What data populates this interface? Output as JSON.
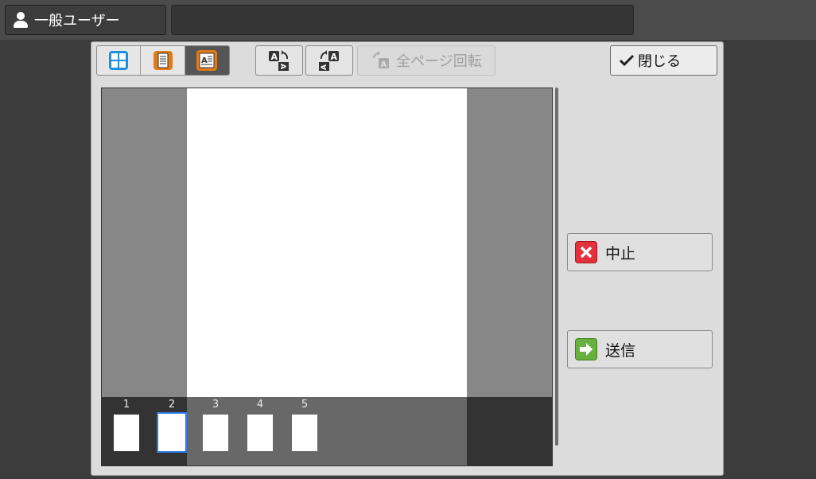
{
  "header": {
    "user_label": "一般ユーザー",
    "message": ""
  },
  "toolbar": {
    "view_modes": [
      {
        "name": "grid",
        "active": false
      },
      {
        "name": "page",
        "active": false
      },
      {
        "name": "page-detail",
        "active": true
      }
    ],
    "rotate_all_label": "全ページ回転",
    "close_label": "閉じる"
  },
  "preview": {
    "thumbnails": [
      {
        "number": "1",
        "selected": false
      },
      {
        "number": "2",
        "selected": true
      },
      {
        "number": "3",
        "selected": false
      },
      {
        "number": "4",
        "selected": false
      },
      {
        "number": "5",
        "selected": false
      }
    ]
  },
  "actions": {
    "stop_label": "中止",
    "send_label": "送信"
  },
  "colors": {
    "accent_blue": "#2f7ae5",
    "stop_red": "#e3323b",
    "send_green": "#69b13f",
    "page_orange": "#e07b17"
  }
}
